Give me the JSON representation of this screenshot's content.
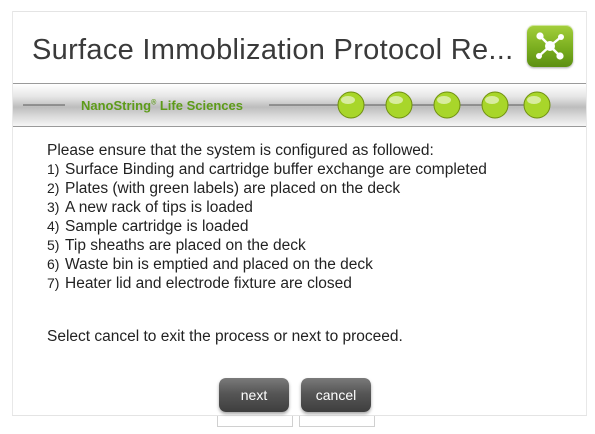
{
  "window": {
    "title": "Surface Immoblization Protocol Re..."
  },
  "banner": {
    "brand_name": "NanoString",
    "brand_mark": "®",
    "brand_suffix": " Life Sciences",
    "progress_total": 5,
    "progress_dots_color": "#a8d62a",
    "accent_color": "#5d9b19"
  },
  "app_icon": {
    "name": "network-nodes-icon",
    "color": "#7aae1f"
  },
  "content": {
    "intro": "Please ensure that the system is configured as followed:",
    "steps": [
      {
        "num": "1)",
        "text": "Surface Binding and cartridge buffer exchange are completed"
      },
      {
        "num": "2)",
        "text": "Plates (with green labels) are placed on the deck"
      },
      {
        "num": "3)",
        "text": "A new rack of tips is loaded"
      },
      {
        "num": "4)",
        "text": "Sample cartridge is loaded"
      },
      {
        "num": "5)",
        "text": "Tip sheaths are placed on the deck"
      },
      {
        "num": "6)",
        "text": "Waste bin is emptied and placed on the deck"
      },
      {
        "num": "7)",
        "text": "Heater lid and electrode fixture are closed"
      }
    ],
    "footer": "Select cancel to exit the process or next to proceed."
  },
  "buttons": {
    "next_label": "next",
    "cancel_label": "cancel"
  }
}
